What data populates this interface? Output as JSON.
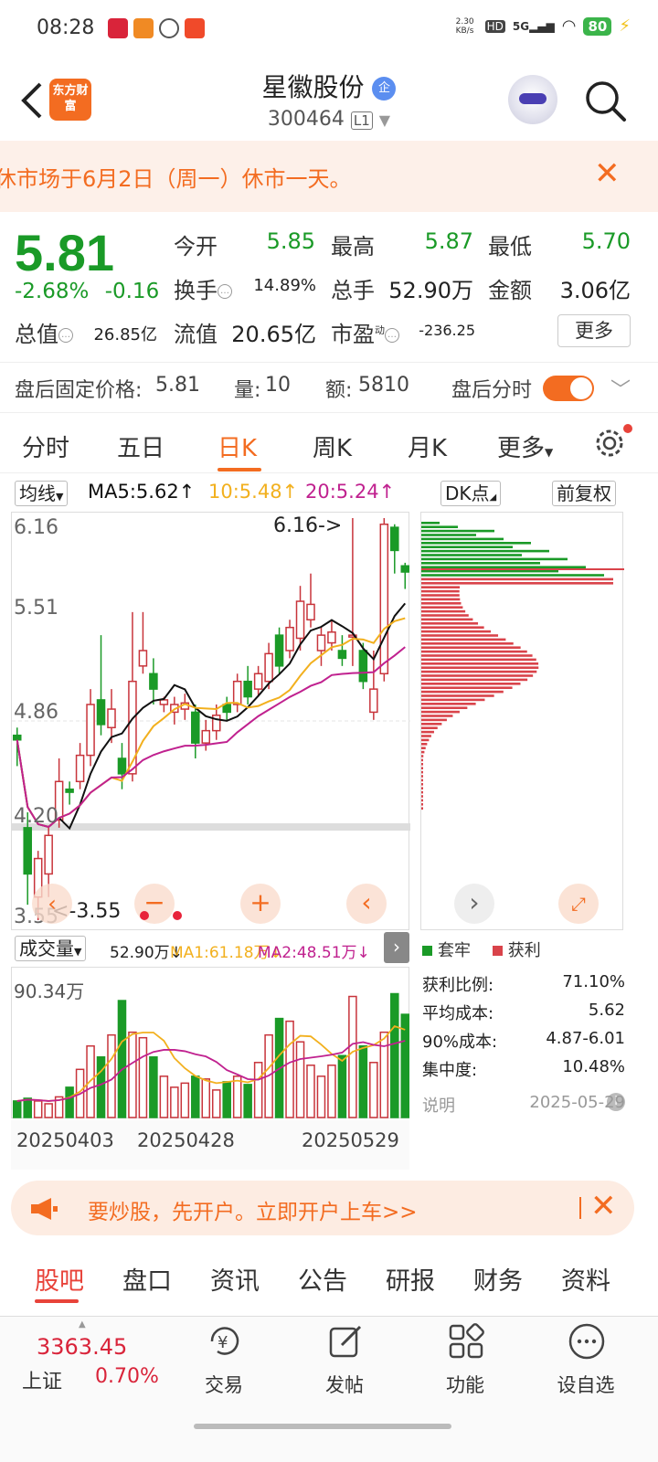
{
  "status_bar": {
    "time": "08:28",
    "net_speed": "2.30 KB/s",
    "hd": "HD",
    "net": "5G",
    "battery": "80"
  },
  "header": {
    "name": "星徽股份",
    "badge": "企",
    "code": "300464",
    "level": "L1",
    "logo_text": "东方财富"
  },
  "notice": {
    "text": "休市场于6月2日（周一）休市一天。",
    "close": "✕"
  },
  "quote": {
    "price": "5.81",
    "change_pct": "-2.68%",
    "change": "-0.16",
    "open_label": "今开",
    "open": "5.85",
    "high_label": "最高",
    "high": "5.87",
    "low_label": "最低",
    "low": "5.70",
    "turnover_label": "换手",
    "turnover": "14.89%",
    "volume_label": "总手",
    "volume": "52.90万",
    "amount_label": "金额",
    "amount": "3.06亿",
    "mktcap_label": "总值",
    "mktcap": "26.85亿",
    "float_label": "流值",
    "float": "20.65亿",
    "pe_label": "市盈",
    "pe_sup": "动",
    "pe": "-236.25",
    "more_label": "更多"
  },
  "after_hours": {
    "price_label": "盘后固定价格:",
    "price": "5.81",
    "vol_label": "量:",
    "vol": "10",
    "amt_label": "额:",
    "amt": "5810",
    "timeshare_label": "盘后分时"
  },
  "ktabs": [
    "分时",
    "五日",
    "日K",
    "周K",
    "月K",
    "更多"
  ],
  "kline": {
    "ma_select": "均线",
    "ma5": "MA5:5.62↑",
    "ma10": "10:5.48↑",
    "ma20": "20:5.24↑",
    "dk": "DK点",
    "adjust": "前复权",
    "y_labels": [
      "6.16",
      "5.51",
      "4.86",
      "4.20",
      "3.55"
    ],
    "max_label": "6.16->",
    "min_label": "<-3.55",
    "vol_select": "成交量",
    "vol_value": "52.90万↓",
    "vol_ma1": "MA1:61.18万↓",
    "vol_ma2": "MA2:48.51万↓",
    "vol_max": "90.34万",
    "dates": [
      "20250403",
      "20250428",
      "20250529"
    ]
  },
  "chips": {
    "trapped_label": "套牢",
    "profit_label": "获利",
    "rows": [
      {
        "label": "获利比例:",
        "value": "71.10%"
      },
      {
        "label": "平均成本:",
        "value": "5.62"
      },
      {
        "label": "90%成本:",
        "value": "4.87-6.01"
      },
      {
        "label": "集中度:",
        "value": "10.48%"
      }
    ],
    "note_label": "说明",
    "date": "2025-05-29"
  },
  "ad": {
    "text": "要炒股，先开户。立即开户上车>>"
  },
  "bottom_tabs": [
    "股吧",
    "盘口",
    "资讯",
    "公告",
    "研报",
    "财务",
    "资料"
  ],
  "bottom_nav": {
    "index_value": "3363.45",
    "index_name": "上证",
    "index_change": "0.70%",
    "items": [
      "交易",
      "发帖",
      "功能",
      "设自选"
    ]
  },
  "colors": {
    "up": "#c8343b",
    "down": "#1a9a27",
    "accent": "#f36c21",
    "ma5": "#111111",
    "ma10": "#f2b01e",
    "ma20": "#c0218f"
  }
}
